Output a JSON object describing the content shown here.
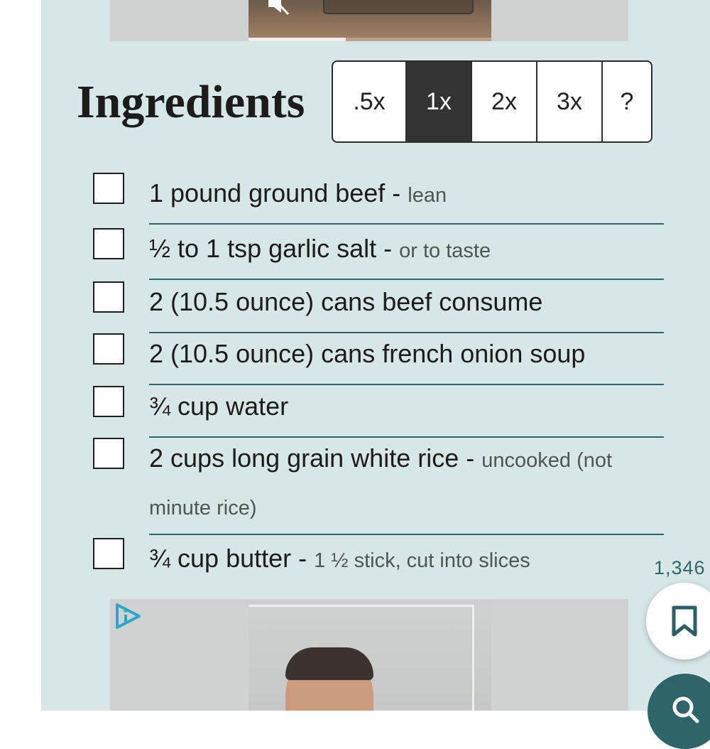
{
  "section": {
    "title": "Ingredients"
  },
  "scale": {
    "options": [
      ".5x",
      "1x",
      "2x",
      "3x",
      "?"
    ],
    "selected": "1x"
  },
  "ingredients": [
    {
      "text": "1 pound ground beef",
      "note": "lean",
      "checked": false
    },
    {
      "text": "½ to 1 tsp garlic salt",
      "note": "or to taste",
      "checked": false
    },
    {
      "text": "2 (10.5 ounce) cans beef consume",
      "note": "",
      "checked": false
    },
    {
      "text": "2 (10.5 ounce) cans french onion soup",
      "note": "",
      "checked": false
    },
    {
      "text": "¾ cup water",
      "note": "",
      "checked": false
    },
    {
      "text": "2 cups long grain white rice",
      "note": "uncooked (not minute rice)",
      "checked": false
    },
    {
      "text": "¾ cup butter",
      "note": "1 ½ stick, cut into slices",
      "checked": false
    }
  ],
  "floating": {
    "save_count": "1,346"
  },
  "video": {
    "progress": 0.4
  },
  "icons": {
    "muted": "speaker-muted-icon",
    "ad_choice": "ad-choice-icon",
    "save": "bookmark-icon",
    "search": "search-icon"
  },
  "colors": {
    "card_background": "#d7e7e7",
    "divider": "#2f6569",
    "accent": "#2f6569",
    "active_scale": "#333333",
    "ad_choice": "#27a9c9"
  }
}
